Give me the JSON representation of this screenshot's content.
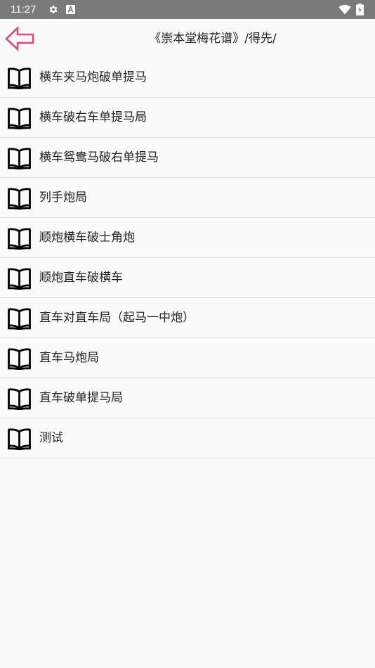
{
  "status_bar": {
    "time": "11:27",
    "icons": [
      "gear-icon",
      "a-icon",
      "wifi-icon",
      "battery-icon"
    ]
  },
  "header": {
    "back_icon": "arrow-left-icon",
    "title": "《崇本堂梅花谱》/得先/"
  },
  "items": [
    {
      "label": "横车夹马炮破单提马",
      "icon": "book-icon"
    },
    {
      "label": "横车破右车单提马局",
      "icon": "book-icon"
    },
    {
      "label": "横车鸳鸯马破右单提马",
      "icon": "book-icon"
    },
    {
      "label": "列手炮局",
      "icon": "book-icon"
    },
    {
      "label": "顺炮横车破士角炮",
      "icon": "book-icon"
    },
    {
      "label": "顺炮直车破横车",
      "icon": "book-icon"
    },
    {
      "label": "直车对直车局（起马一中炮）",
      "icon": "book-icon"
    },
    {
      "label": "直车马炮局",
      "icon": "book-icon"
    },
    {
      "label": "直车破单提马局",
      "icon": "book-icon"
    },
    {
      "label": "测试",
      "icon": "book-icon"
    }
  ],
  "colors": {
    "status_bar": "#7a7a7a",
    "background": "#fafafa",
    "accent": "#e8467a",
    "divider": "#d9d9d9"
  }
}
